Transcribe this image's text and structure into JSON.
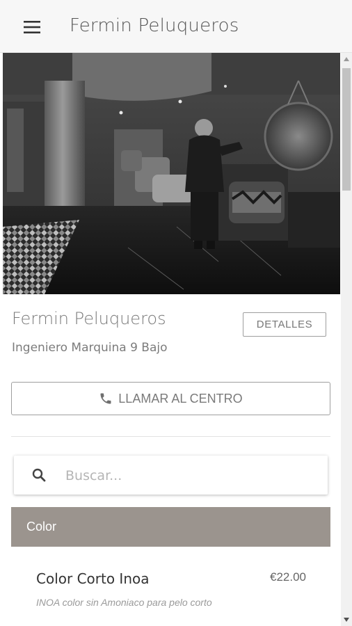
{
  "app_bar": {
    "menu_icon": "hamburger-menu-icon",
    "title": "Fermin Peluqueros"
  },
  "salon": {
    "name": "Fermin Peluqueros",
    "address": "Ingeniero Marquina 9 Bajo",
    "details_label": "DETALLES",
    "call_label": "LLAMAR AL CENTRO",
    "call_icon": "phone-icon"
  },
  "search": {
    "icon": "search-icon",
    "placeholder": "Buscar..."
  },
  "category": {
    "label": "Color",
    "color": "#9b948e"
  },
  "services": [
    {
      "name": "Color Corto Inoa",
      "price": "€22.00",
      "description": "INOA color sin Amoniaco para pelo corto"
    }
  ]
}
